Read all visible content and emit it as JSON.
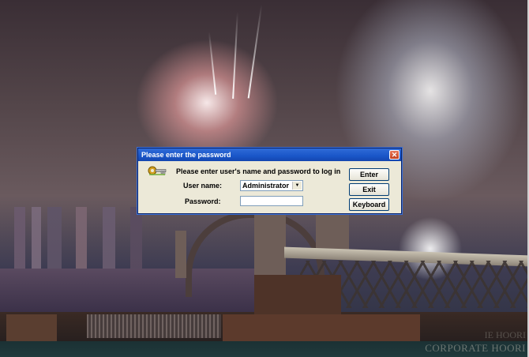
{
  "dialog": {
    "title": "Please enter the password",
    "close_glyph": "✕",
    "prompt": "Please enter user's name and password to log in",
    "username_label": "User name:",
    "username_value": "Administrator",
    "password_label": "Password:",
    "password_value": "",
    "buttons": {
      "enter": "Enter",
      "exit": "Exit",
      "keyboard": "Keyboard"
    }
  },
  "watermark": {
    "text": "CORPORATE HOORI",
    "partial_text": "IE HOORI"
  },
  "colors": {
    "titlebar": "#1a56c8",
    "dialog_bg": "#ece9d8",
    "close": "#c2401f"
  },
  "icons": {
    "key": "key-icon",
    "close": "close-icon",
    "dropdown": "chevron-down-icon"
  }
}
